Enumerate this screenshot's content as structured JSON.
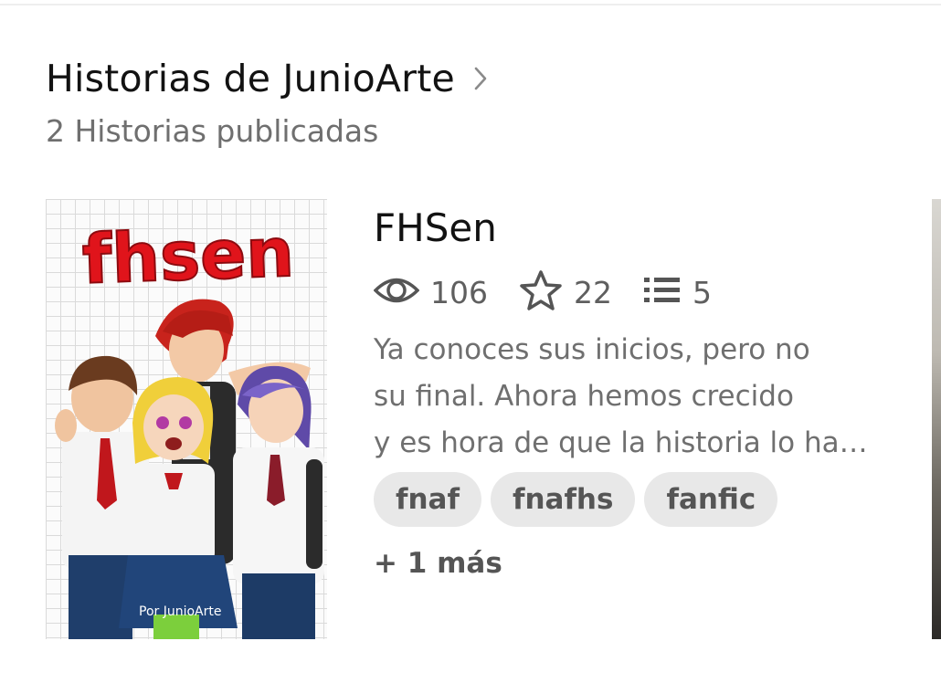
{
  "section": {
    "title": "Historias de JunioArte",
    "subtitle": "2 Historias publicadas",
    "chevron_icon": "chevron-right-icon"
  },
  "story": {
    "cover": {
      "title_art": "fhsen",
      "credit": "Por JunioArte",
      "title_color": "#e0141b"
    },
    "title": "FHSen",
    "stats": {
      "views": "106",
      "votes": "22",
      "parts": "5",
      "views_icon": "eye-icon",
      "votes_icon": "star-icon",
      "parts_icon": "list-icon"
    },
    "description_lines": [
      "Ya conoces sus inicios, pero no",
      "su final. Ahora hemos crecido",
      "y es hora de que la historia lo ha…"
    ],
    "tags": [
      "fnaf",
      "fnafhs",
      "fanfic"
    ],
    "more_tags": "+ 1 más"
  },
  "colors": {
    "text_primary": "#121212",
    "text_secondary": "#6f6f6f",
    "tag_bg": "#e8e8e8"
  }
}
